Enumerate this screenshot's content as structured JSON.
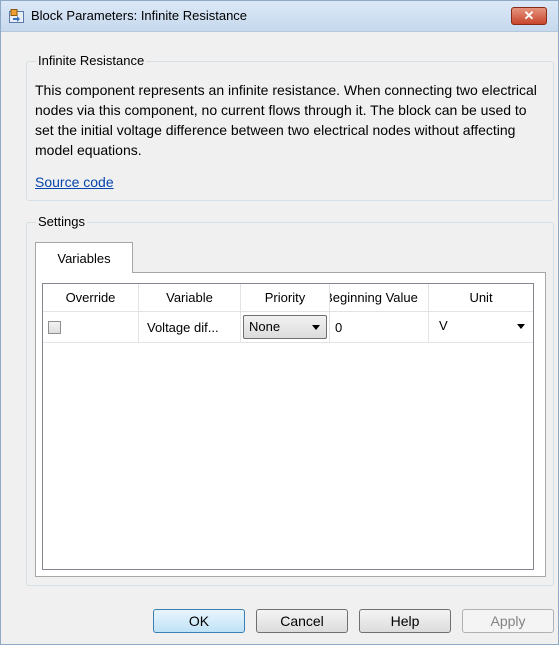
{
  "window": {
    "title": "Block Parameters: Infinite Resistance",
    "close_glyph": "✕"
  },
  "description_group": {
    "title": "Infinite Resistance",
    "text": "This component represents an infinite resistance. When connecting two electrical nodes via this component, no current flows through it. The block can be used to set the initial voltage difference between two electrical nodes without affecting model equations.",
    "link": "Source code"
  },
  "settings_group": {
    "title": "Settings",
    "tab_label": "Variables"
  },
  "table": {
    "headers": [
      "Override",
      "Variable",
      "Priority",
      "Beginning Value",
      "Unit"
    ],
    "rows": [
      {
        "override_checked": false,
        "variable": "Voltage dif...",
        "priority": "None",
        "beginning_value": "0",
        "unit": "V"
      }
    ]
  },
  "buttons": {
    "ok": "OK",
    "cancel": "Cancel",
    "help": "Help",
    "apply": "Apply"
  },
  "colors": {
    "titlebar": "#c7d9ee",
    "close": "#c8452b",
    "link": "#0645ad",
    "default_button": "#bfe2f7"
  },
  "icons": {
    "app": "simulink-block-icon",
    "close": "close-icon",
    "dropdown": "chevron-down-icon"
  }
}
